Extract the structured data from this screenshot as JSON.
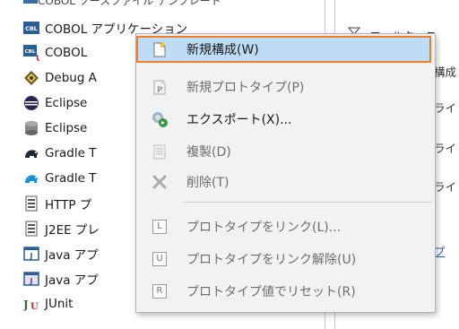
{
  "tree": {
    "cut_top_label": "COBOL ソースファイル テンプレート",
    "items": [
      {
        "label": "COBOL アプリケーション",
        "icon": "cobol-app-icon"
      },
      {
        "label": "COBOL",
        "icon": "cobol-unit-icon"
      },
      {
        "label": "Debug A",
        "icon": "debug-icon"
      },
      {
        "label": "Eclipse",
        "icon": "eclipse-icon"
      },
      {
        "label": "Eclipse",
        "icon": "database-icon"
      },
      {
        "label": "Gradle T",
        "icon": "gradle-icon"
      },
      {
        "label": "Gradle T",
        "icon": "gradle-blue-icon"
      },
      {
        "label": "HTTP プ",
        "icon": "http-icon"
      },
      {
        "label": "J2EE プレ",
        "icon": "j2ee-icon"
      },
      {
        "label": "Java アプ",
        "icon": "java-app-icon"
      },
      {
        "label": "Java アプ",
        "icon": "java-applet-icon"
      },
      {
        "label": "JUnit",
        "icon": "junit-icon"
      }
    ]
  },
  "right_panel": {
    "filter_label": "- フィルタ・ス",
    "text1": "構成",
    "text2": "ライ",
    "text3": "ライ",
    "text4": "ライ",
    "link": "プ"
  },
  "context_menu": {
    "items": [
      {
        "label": "新規構成(W)",
        "icon": "new-config-icon",
        "enabled": true,
        "highlighted": true
      },
      {
        "label": "新規プロトタイプ(P)",
        "icon": "new-prototype-icon",
        "enabled": false
      },
      {
        "label": "エクスポート(X)...",
        "icon": "export-icon",
        "enabled": true
      },
      {
        "label": "複製(D)",
        "icon": "duplicate-icon",
        "enabled": false
      },
      {
        "label": "削除(T)",
        "icon": "delete-icon",
        "enabled": false
      },
      {
        "label": "プロトタイプをリンク(L)...",
        "icon": "link-prototype-icon",
        "enabled": false,
        "icon_letter": "L"
      },
      {
        "label": "プロトタイプをリンク解除(U)",
        "icon": "unlink-prototype-icon",
        "enabled": false,
        "icon_letter": "U"
      },
      {
        "label": "プロトタイプ値でリセット(R)",
        "icon": "reset-prototype-icon",
        "enabled": false,
        "icon_letter": "R"
      }
    ]
  },
  "colors": {
    "highlight_bg": "#bfdcf6",
    "highlight_border": "#ee7d2c",
    "menu_bg": "#f2f2f2",
    "link": "#2a5db0"
  }
}
